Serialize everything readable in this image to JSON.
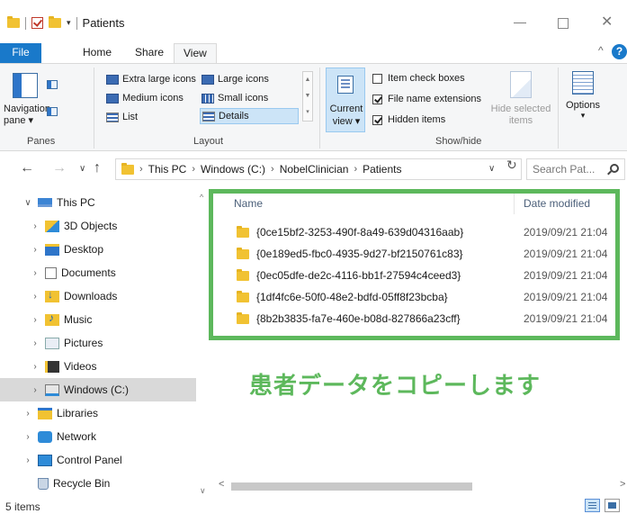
{
  "window": {
    "title": "Patients",
    "controls": {
      "minimize": "—",
      "maximize": "",
      "close": "✕"
    }
  },
  "ribbon_tabs": [
    {
      "label": "File"
    },
    {
      "label": "Home"
    },
    {
      "label": "Share"
    },
    {
      "label": "View"
    }
  ],
  "ribbon": {
    "panes": {
      "navigation_pane_label": "Navigation pane ▾",
      "group_label": "Panes"
    },
    "layout": {
      "group_label": "Layout",
      "items": [
        {
          "label": "Extra large icons"
        },
        {
          "label": "Large icons"
        },
        {
          "label": "Medium icons"
        },
        {
          "label": "Small icons"
        },
        {
          "label": "List"
        },
        {
          "label": "Details",
          "selected": true
        }
      ]
    },
    "current_view": {
      "label": "Current view ▾"
    },
    "show_hide": {
      "group_label": "Show/hide",
      "checkboxes": [
        {
          "label": "Item check boxes",
          "checked": false
        },
        {
          "label": "File name extensions",
          "checked": true
        },
        {
          "label": "Hidden items",
          "checked": true
        }
      ],
      "hide_selected_label": "Hide selected items"
    },
    "options_label": "Options"
  },
  "address_bar": {
    "breadcrumbs": [
      "This PC",
      "Windows (C:)",
      "NobelClinician",
      "Patients"
    ],
    "search_placeholder": "Search Pat..."
  },
  "nav_tree": [
    {
      "label": "This PC",
      "expanded": true,
      "icon": "this-pc-icon"
    },
    {
      "label": "3D Objects",
      "icon": "3d-objects-icon"
    },
    {
      "label": "Desktop",
      "icon": "desktop-icon"
    },
    {
      "label": "Documents",
      "icon": "documents-icon"
    },
    {
      "label": "Downloads",
      "icon": "downloads-icon"
    },
    {
      "label": "Music",
      "icon": "music-icon"
    },
    {
      "label": "Pictures",
      "icon": "pictures-icon"
    },
    {
      "label": "Videos",
      "icon": "videos-icon"
    },
    {
      "label": "Windows (C:)",
      "icon": "drive-icon",
      "selected": true
    },
    {
      "label": "Libraries",
      "icon": "libraries-icon"
    },
    {
      "label": "Network",
      "icon": "network-icon"
    },
    {
      "label": "Control Panel",
      "icon": "control-panel-icon"
    },
    {
      "label": "Recycle Bin",
      "icon": "recycle-bin-icon"
    }
  ],
  "file_list": {
    "columns": {
      "name": "Name",
      "date_modified": "Date modified"
    },
    "rows": [
      {
        "name": "{0ce15bf2-3253-490f-8a49-639d04316aab}",
        "date": "2019/09/21 21:04"
      },
      {
        "name": "{0e189ed5-fbc0-4935-9d27-bf2150761c83}",
        "date": "2019/09/21 21:04"
      },
      {
        "name": "{0ec05dfe-de2c-4116-bb1f-27594c4ceed3}",
        "date": "2019/09/21 21:04"
      },
      {
        "name": "{1df4fc6e-50f0-48e2-bdfd-05ff8f23bcba}",
        "date": "2019/09/21 21:04"
      },
      {
        "name": "{8b2b3835-fa7e-460e-b08d-827866a23cff}",
        "date": "2019/09/21 21:04"
      }
    ]
  },
  "annotation": {
    "text": "患者データをコピーします",
    "color": "#5db85c"
  },
  "status_bar": {
    "item_count": "5 items"
  },
  "colors": {
    "accent": "#1979ca",
    "highlight": "#5db85c"
  }
}
